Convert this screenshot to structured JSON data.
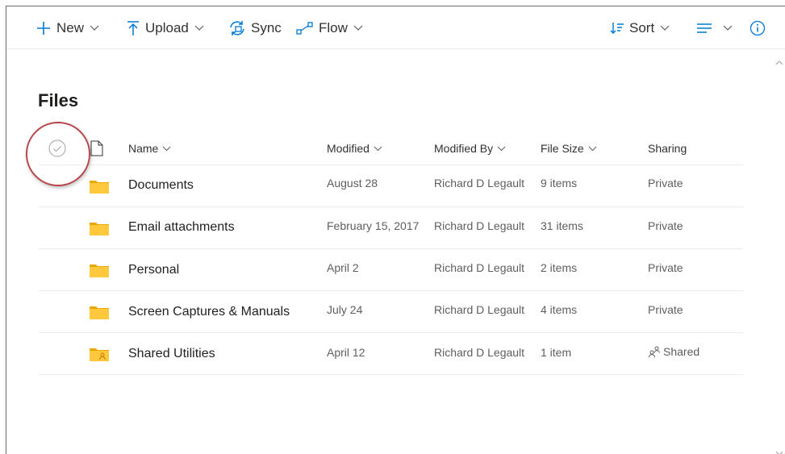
{
  "toolbar": {
    "new_label": "New",
    "upload_label": "Upload",
    "sync_label": "Sync",
    "flow_label": "Flow",
    "sort_label": "Sort"
  },
  "page": {
    "title": "Files"
  },
  "columns": {
    "name": "Name",
    "modified": "Modified",
    "modified_by": "Modified By",
    "file_size": "File Size",
    "sharing": "Sharing"
  },
  "rows": [
    {
      "name": "Documents",
      "modified": "August 28",
      "modified_by": "Richard D Legault",
      "file_size": "9 items",
      "sharing": "Private",
      "icon": "folder-icon"
    },
    {
      "name": "Email attachments",
      "modified": "February 15, 2017",
      "modified_by": "Richard D Legault",
      "file_size": "31 items",
      "sharing": "Private",
      "icon": "folder-icon"
    },
    {
      "name": "Personal",
      "modified": "April 2",
      "modified_by": "Richard D Legault",
      "file_size": "2 items",
      "sharing": "Private",
      "icon": "folder-icon"
    },
    {
      "name": "Screen Captures & Manuals",
      "modified": "July 24",
      "modified_by": "Richard D Legault",
      "file_size": "4 items",
      "sharing": "Private",
      "icon": "folder-icon"
    },
    {
      "name": "Shared Utilities",
      "modified": "April 12",
      "modified_by": "Richard D Legault",
      "file_size": "1 item",
      "sharing": "Shared",
      "icon": "shared-folder-icon"
    }
  ],
  "colors": {
    "accent": "#0078d4",
    "folder": "#ffc83d",
    "folder_dark": "#e8a800",
    "highlight": "#b5454a"
  }
}
